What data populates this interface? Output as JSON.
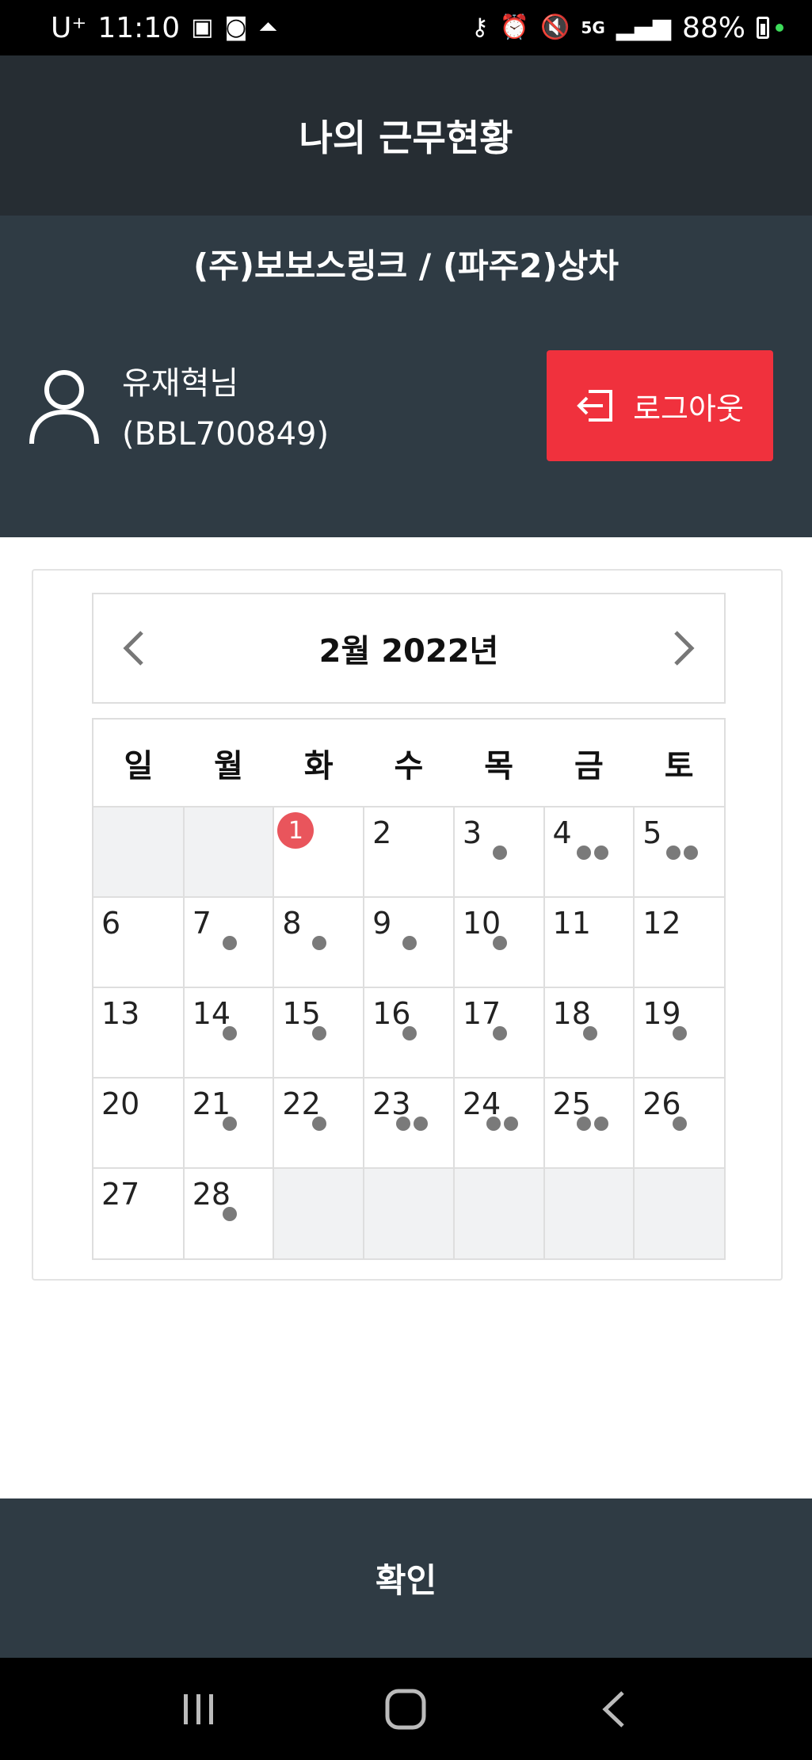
{
  "status_bar": {
    "carrier": "U⁺",
    "time": "11:10",
    "battery": "88%",
    "network": "5G"
  },
  "header": {
    "title": "나의 근무현황"
  },
  "user": {
    "company": "(주)보보스링크 / (파주2)상차",
    "name": "유재혁님",
    "employee_id": "(BBL700849)",
    "logout_label": "로그아웃"
  },
  "calendar": {
    "title": "2월 2022년",
    "weekdays": [
      "일",
      "월",
      "화",
      "수",
      "목",
      "금",
      "토"
    ],
    "weeks": [
      [
        {
          "day": ""
        },
        {
          "day": ""
        },
        {
          "day": "1",
          "today": true,
          "dots": 0
        },
        {
          "day": "2",
          "dots": 0
        },
        {
          "day": "3",
          "dots": 1
        },
        {
          "day": "4",
          "dots": 2
        },
        {
          "day": "5",
          "dots": 2
        }
      ],
      [
        {
          "day": "6",
          "dots": 0
        },
        {
          "day": "7",
          "dots": 1
        },
        {
          "day": "8",
          "dots": 1
        },
        {
          "day": "9",
          "dots": 1
        },
        {
          "day": "10",
          "dots": 1
        },
        {
          "day": "11",
          "dots": 0
        },
        {
          "day": "12",
          "dots": 0
        }
      ],
      [
        {
          "day": "13",
          "dots": 0
        },
        {
          "day": "14",
          "dots": 1
        },
        {
          "day": "15",
          "dots": 1
        },
        {
          "day": "16",
          "dots": 1
        },
        {
          "day": "17",
          "dots": 1
        },
        {
          "day": "18",
          "dots": 1
        },
        {
          "day": "19",
          "dots": 1
        }
      ],
      [
        {
          "day": "20",
          "dots": 0
        },
        {
          "day": "21",
          "dots": 1
        },
        {
          "day": "22",
          "dots": 1
        },
        {
          "day": "23",
          "dots": 2
        },
        {
          "day": "24",
          "dots": 2
        },
        {
          "day": "25",
          "dots": 2
        },
        {
          "day": "26",
          "dots": 1
        }
      ],
      [
        {
          "day": "27",
          "dots": 0
        },
        {
          "day": "28",
          "dots": 1
        },
        {
          "day": ""
        },
        {
          "day": ""
        },
        {
          "day": ""
        },
        {
          "day": ""
        },
        {
          "day": ""
        }
      ]
    ]
  },
  "footer": {
    "confirm_label": "확인"
  },
  "icons": {
    "user": "user-icon",
    "logout": "logout-icon",
    "prev": "chevron-left-icon",
    "next": "chevron-right-icon"
  },
  "colors": {
    "header_bg": "#262d33",
    "section_bg": "#2f3b44",
    "logout_bg": "#f0313d",
    "today_badge": "#e9555c",
    "dot": "#7a7a7a"
  }
}
